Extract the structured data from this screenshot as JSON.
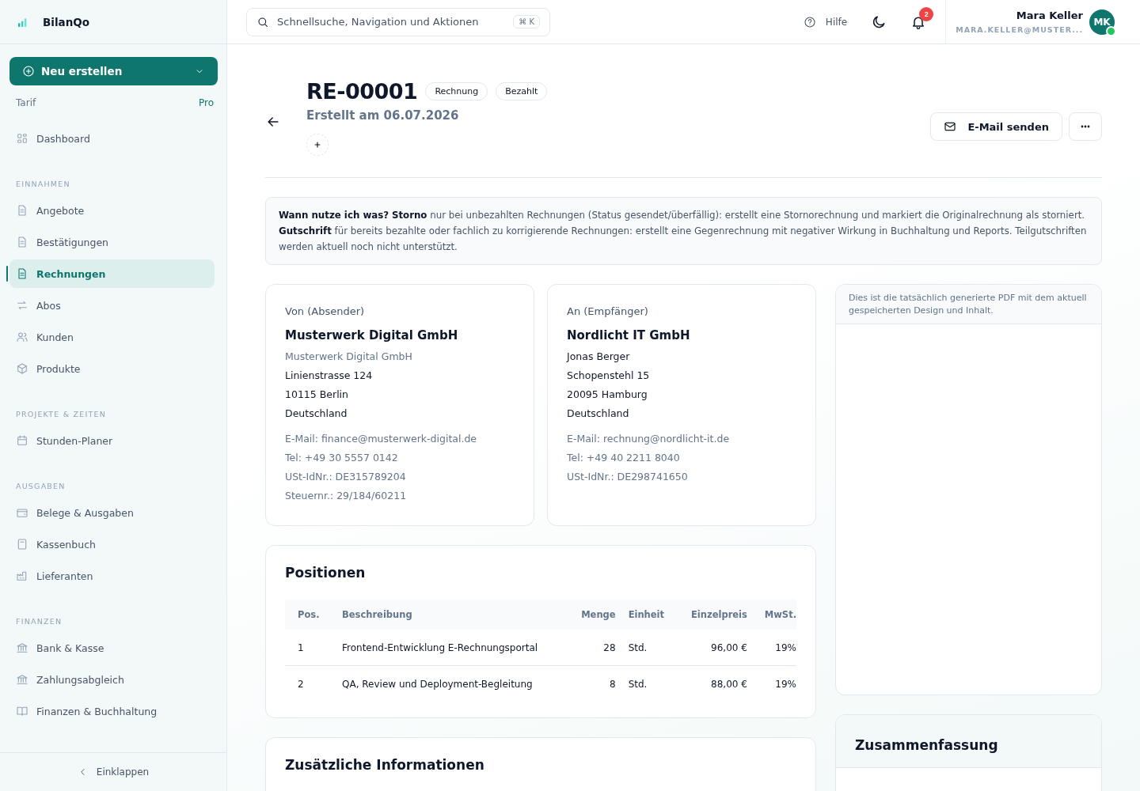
{
  "brand": {
    "name": "BilanQo"
  },
  "sidebar": {
    "create_button": "Neu erstellen",
    "plan": {
      "label": "Tarif",
      "value": "Pro"
    },
    "sections": [
      {
        "items": [
          {
            "label": "Dashboard",
            "selected": false
          }
        ]
      },
      {
        "title": "EINNAHMEN",
        "items": [
          {
            "label": "Angebote",
            "selected": false
          },
          {
            "label": "Bestätigungen",
            "selected": false
          },
          {
            "label": "Rechnungen",
            "selected": true
          },
          {
            "label": "Abos",
            "selected": false
          },
          {
            "label": "Kunden",
            "selected": false
          },
          {
            "label": "Produkte",
            "selected": false
          }
        ]
      },
      {
        "title": "PROJEKTE & ZEITEN",
        "items": [
          {
            "label": "Stunden-Planer",
            "selected": false
          }
        ]
      },
      {
        "title": "AUSGABEN",
        "items": [
          {
            "label": "Belege & Ausgaben",
            "selected": false
          },
          {
            "label": "Kassenbuch",
            "selected": false
          },
          {
            "label": "Lieferanten",
            "selected": false
          }
        ]
      },
      {
        "title": "FINANZEN",
        "items": [
          {
            "label": "Bank & Kasse",
            "selected": false
          },
          {
            "label": "Zahlungsabgleich",
            "selected": false
          },
          {
            "label": "Finanzen & Buchhaltung",
            "selected": false
          }
        ]
      }
    ],
    "collapse": "Einklappen"
  },
  "topbar": {
    "search": {
      "placeholder": "Schnellsuche, Navigation und Aktionen",
      "shortcut": "⌘ K"
    },
    "help": "Hilfe",
    "notifications": "2",
    "user": {
      "name": "Mara Keller",
      "email": "MARA.KELLER@MUSTER...",
      "initials": "MK",
      "online": true
    }
  },
  "header": {
    "title": "RE-00001",
    "badges": [
      "Rechnung",
      "Bezahlt"
    ],
    "subtitle": "Erstellt am 06.07.2026",
    "actions": {
      "email": "E-Mail senden"
    }
  },
  "notice": "**Wann nutze ich was?** **Storno** nur bei unbezahlten Rechnungen (Status gesendet/überfällig): erstellt eine Stornorechnung und markiert die Originalrechnung als storniert. **Gutschrift** für bereits bezahlte oder fachlich zu korrigierende Rechnungen: erstellt eine Gegenrechnung mit negativer Wirkung in Buchhaltung und Reports. Teilgutschriften werden aktuell noch nicht unterstützt.",
  "parties": [
    {
      "heading": "Von (Absender)",
      "company": "Musterwerk Digital GmbH",
      "address": [
        {
          "text": "Musterwerk Digital GmbH",
          "muted": true
        },
        {
          "text": "Linienstrasse 124",
          "muted": false
        },
        {
          "text": "10115 Berlin",
          "muted": false
        },
        {
          "text": "Deutschland",
          "muted": false
        }
      ],
      "contact": [
        "E-Mail: finance@musterwerk-digital.de",
        "Tel: +49 30 5557 0142",
        "USt-IdNr.: DE315789204",
        "Steuernr.: 29/184/60211"
      ]
    },
    {
      "heading": "An (Empfänger)",
      "company": "Nordlicht IT GmbH",
      "address": [
        {
          "text": "Jonas Berger",
          "muted": false
        },
        {
          "text": "Schopenstehl 15",
          "muted": false
        },
        {
          "text": "20095 Hamburg",
          "muted": false
        },
        {
          "text": "Deutschland",
          "muted": false
        }
      ],
      "contact": [
        "E-Mail: rechnung@nordlicht-it.de",
        "Tel: +49 40 2211 8040",
        "USt-IdNr.: DE298741650"
      ]
    }
  ],
  "positions": {
    "title": "Positionen",
    "columns": [
      "Pos.",
      "Beschreibung",
      "Menge",
      "Einheit",
      "Einzelpreis",
      "MwSt."
    ],
    "rows": [
      [
        "1",
        "Frontend-Entwicklung E-Rechnungsportal",
        "28",
        "Std.",
        "96,00 €",
        "19%"
      ],
      [
        "2",
        "QA, Review und Deployment-Begleitung",
        "8",
        "Std.",
        "88,00 €",
        "19%"
      ]
    ]
  },
  "extra": {
    "title": "Zusätzliche Informationen"
  },
  "preview": {
    "note": "Dies ist die tatsächlich generierte PDF mit dem aktuell gespeicherten Design und Inhalt."
  },
  "summary": {
    "title": "Zusammenfassung"
  }
}
